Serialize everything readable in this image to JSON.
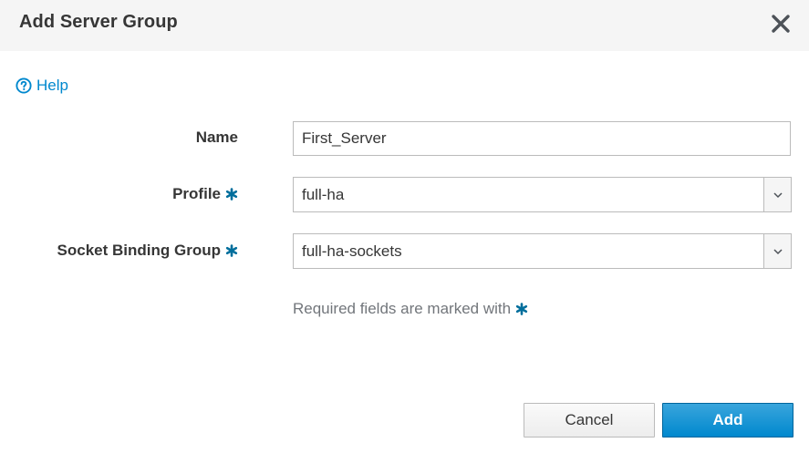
{
  "dialog": {
    "title": "Add Server Group",
    "close_icon": "close-icon"
  },
  "help": {
    "icon": "question-circle-icon",
    "label": "Help"
  },
  "form": {
    "name": {
      "label": "Name",
      "value": "First_Server",
      "required": false
    },
    "profile": {
      "label": "Profile",
      "value": "full-ha",
      "required": true
    },
    "socket_binding_group": {
      "label": "Socket Binding Group",
      "value": "full-ha-sockets",
      "required": true
    },
    "required_note": "Required fields are marked with",
    "required_marker": "✱"
  },
  "buttons": {
    "cancel": "Cancel",
    "add": "Add"
  },
  "colors": {
    "header_bg": "#f5f5f5",
    "link": "#0088ce",
    "required_star": "#006e9c",
    "primary_button": "#0088ce",
    "muted_text": "#72767b"
  }
}
